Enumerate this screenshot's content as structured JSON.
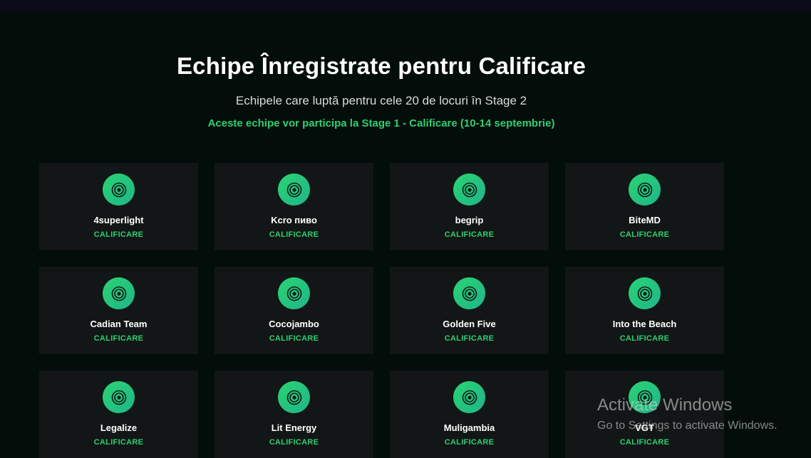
{
  "header": {
    "title": "Echipe Înregistrate pentru Calificare",
    "subtitle": "Echipele care luptă pentru cele 20 de locuri în Stage 2",
    "notice": "Aceste echipe vor participa la Stage 1 - Calificare (10-14 septembrie)"
  },
  "teams": [
    {
      "name": "4superlight",
      "status": "CALIFICARE"
    },
    {
      "name": "Kcro пиво",
      "status": "CALIFICARE"
    },
    {
      "name": "begrip",
      "status": "CALIFICARE"
    },
    {
      "name": "BiteMD",
      "status": "CALIFICARE"
    },
    {
      "name": "Cadian Team",
      "status": "CALIFICARE"
    },
    {
      "name": "Cocojambo",
      "status": "CALIFICARE"
    },
    {
      "name": "Golden Five",
      "status": "CALIFICARE"
    },
    {
      "name": "Into the Beach",
      "status": "CALIFICARE"
    },
    {
      "name": "Legalize",
      "status": "CALIFICARE"
    },
    {
      "name": "Lit Energy",
      "status": "CALIFICARE"
    },
    {
      "name": "Muligambia",
      "status": "CALIFICARE"
    },
    {
      "name": "VGT",
      "status": "CALIFICARE"
    }
  ],
  "team_icon": "target-icon",
  "colors": {
    "background": "#030d0a",
    "card": "#121616",
    "accent": "#2fcf72",
    "icon_gradient_start": "#2ad472",
    "icon_gradient_end": "#1fb58b"
  },
  "watermark": {
    "title": "Activate Windows",
    "subtitle": "Go to Settings to activate Windows."
  }
}
